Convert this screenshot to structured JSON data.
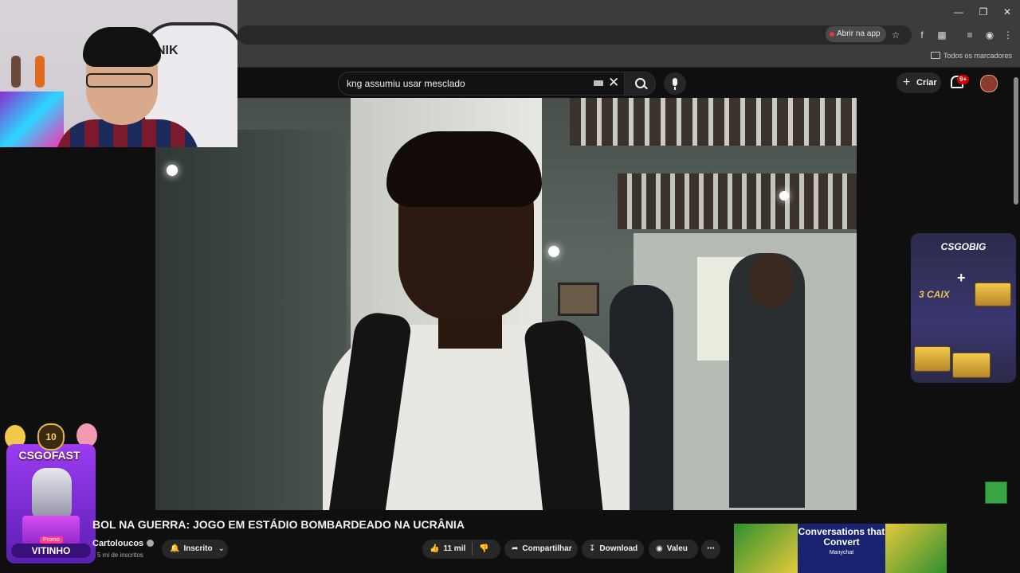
{
  "browser": {
    "open_app_label": "Abrir na app",
    "bookmarks_label": "Todos os marcadores",
    "window_controls": [
      "minimize-icon",
      "restore-icon",
      "close-icon"
    ]
  },
  "youtube": {
    "search_query": "kng assumiu usar mesclado",
    "create_label": "Criar",
    "notifications_badge": "9+"
  },
  "video": {
    "title": "BOL NA GUERRA: JOGO EM ESTÁDIO BOMBARDEADO NA UCRÂNIA",
    "channel": "Cartoloucos",
    "subscribers": "5 mi de inscritos",
    "subscribe_label": "Inscrito",
    "like_count": "11 mil",
    "share_label": "Compartilhar",
    "download_label": "Download",
    "thanks_label": "Valeu"
  },
  "overlays": {
    "webcam_chair_logo": "NIK",
    "left_promo": {
      "badge": "10",
      "brand": "CSGOFAST",
      "tag": "Promo",
      "name": "VITINHO"
    },
    "right_promo": {
      "brand": "CSGOBIG",
      "text": "3 CAIX"
    }
  },
  "ad": {
    "headline": "Conversations that Convert",
    "brand": "Manychat"
  }
}
